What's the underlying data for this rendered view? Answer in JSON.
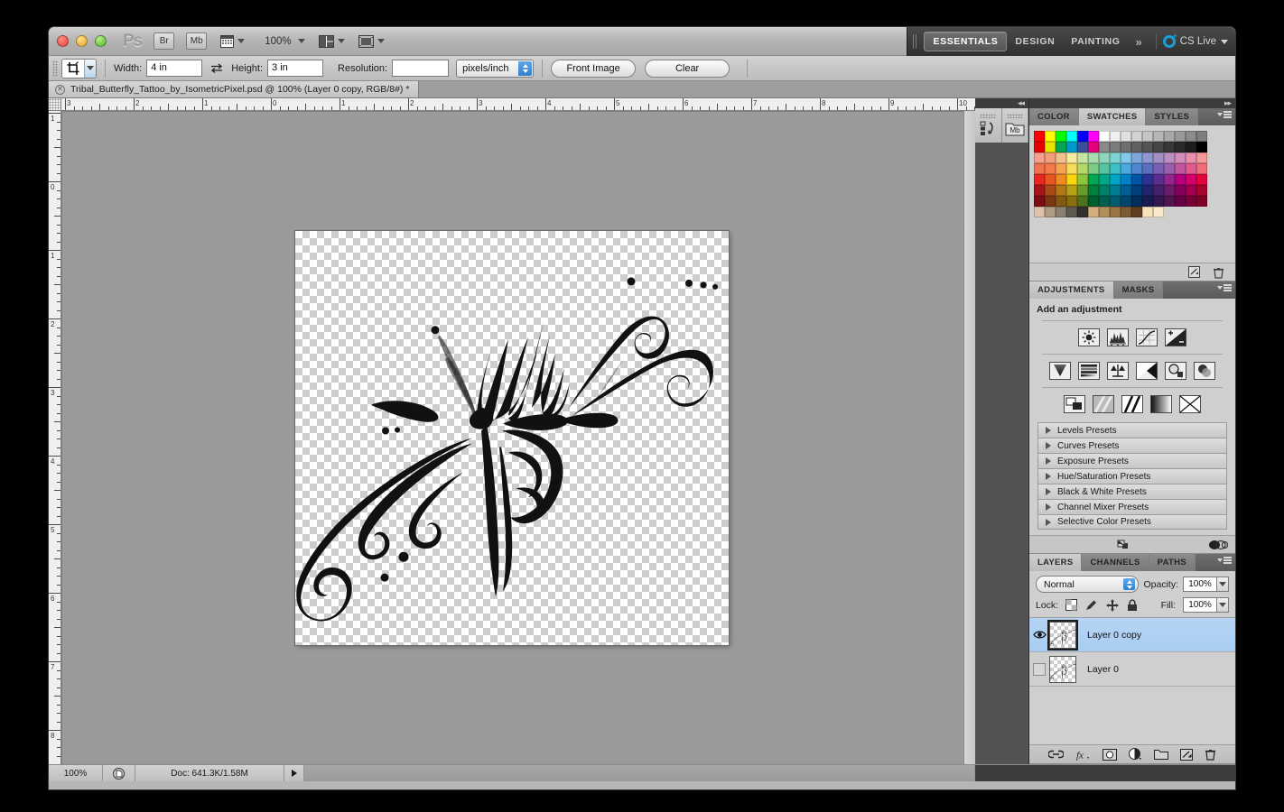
{
  "app": {
    "name": "Adobe Photoshop CS5",
    "logo_text": "Ps"
  },
  "titlebar": {
    "bridge_button": "Br",
    "minibridge_button": "Mb",
    "view_extras_icon": "view-extras-icon",
    "zoom_level": "100%",
    "arrange_icon": "arrange-documents-icon",
    "screenmode_icon": "screen-mode-icon",
    "workspaces": [
      {
        "label": "ESSENTIALS",
        "active": true
      },
      {
        "label": "DESIGN",
        "active": false
      },
      {
        "label": "PAINTING",
        "active": false
      }
    ],
    "more_workspaces": "»",
    "cs_live": "CS Live"
  },
  "options_bar": {
    "tool_icon": "crop-tool-icon",
    "width_label": "Width:",
    "width_value": "4 in",
    "swap_icon": "swap-dimensions-icon",
    "height_label": "Height:",
    "height_value": "3 in",
    "resolution_label": "Resolution:",
    "resolution_value": "",
    "units_value": "pixels/inch",
    "front_image_button": "Front Image",
    "clear_button": "Clear"
  },
  "document_tab": {
    "close_icon": "close-document-icon",
    "title": "Tribal_Butterfly_Tattoo_by_IsometricPixel.psd @ 100% (Layer 0 copy, RGB/8#) *"
  },
  "rulers": {
    "horizontal_labels": [
      "3",
      "2",
      "1",
      "0",
      "1",
      "2",
      "3",
      "4",
      "5",
      "6",
      "7",
      "8",
      "9",
      "10"
    ],
    "vertical_labels": [
      "1",
      "0",
      "1",
      "2",
      "3",
      "4",
      "5",
      "6",
      "7",
      "8"
    ],
    "unit": "inches"
  },
  "canvas": {
    "artwork_name": "tribal-butterfly-tattoo-artwork",
    "background": "transparent-checkerboard"
  },
  "collapsed_dock": {
    "items": [
      {
        "name": "history-panel-icon",
        "label": "History"
      },
      {
        "name": "mini-bridge-panel-icon",
        "label": "Mb"
      }
    ]
  },
  "swatches_panel": {
    "tabs": [
      {
        "label": "COLOR",
        "active": false
      },
      {
        "label": "SWATCHES",
        "active": true
      },
      {
        "label": "STYLES",
        "active": false
      }
    ],
    "menu_icon": "panel-menu-icon",
    "new_swatch_icon": "new-swatch-icon",
    "delete_swatch_icon": "delete-swatch-icon",
    "colors": [
      [
        "#ff0000",
        "#ffff00",
        "#00ff00",
        "#00ffff",
        "#0000ff",
        "#ff00ff",
        "#ffffff",
        "#f0f0f0",
        "#e0e0e0",
        "#d2d2d2",
        "#c4c4c4",
        "#b6b6b6",
        "#a8a8a8",
        "#9a9a9a",
        "#8c8c8c",
        "#7e7e7e"
      ],
      [
        "#e60000",
        "#e6e600",
        "#00a651",
        "#0099cc",
        "#3b4f9e",
        "#e6007e",
        "#8a8a8a",
        "#7d7d7d",
        "#6f6f6f",
        "#616161",
        "#545454",
        "#464646",
        "#383838",
        "#2b2b2b",
        "#1d1d1d",
        "#000000"
      ],
      [
        "#f4a08b",
        "#f2a07c",
        "#f5c08a",
        "#f7e9a0",
        "#c9e3a0",
        "#a8dcae",
        "#8ed6bd",
        "#7fd2d2",
        "#84c8ea",
        "#7ea8dd",
        "#8e97cf",
        "#a18fc6",
        "#bb8fc2",
        "#d48cbb",
        "#ea8fae",
        "#f29a9a"
      ],
      [
        "#f2714f",
        "#f37b4a",
        "#f5a351",
        "#f7dc5c",
        "#b4d96a",
        "#7ecb86",
        "#57c4a2",
        "#3dbfc6",
        "#4aa9e0",
        "#4f86cf",
        "#5b6fc0",
        "#7a60b5",
        "#9a5fae",
        "#c055a0",
        "#e05b8e",
        "#ef6d78"
      ],
      [
        "#e8281f",
        "#e8561f",
        "#ef8b1f",
        "#f7d60f",
        "#8cc63f",
        "#00a651",
        "#00a887",
        "#00a5c6",
        "#0080c8",
        "#0054a6",
        "#2e3192",
        "#5c2d91",
        "#92278f",
        "#b5007d",
        "#d6006a",
        "#e3053b"
      ],
      [
        "#a81418",
        "#aa4a17",
        "#b07a16",
        "#b5a315",
        "#6b9a2c",
        "#00803e",
        "#008069",
        "#007e97",
        "#005f98",
        "#00407d",
        "#22246e",
        "#44216c",
        "#6d1a6b",
        "#88005d",
        "#a0004e",
        "#aa0430"
      ],
      [
        "#7c0d14",
        "#7d3612",
        "#825a11",
        "#876f10",
        "#4e7320",
        "#005f2e",
        "#005f4e",
        "#005d70",
        "#004670",
        "#002f5d",
        "#191b52",
        "#331850",
        "#521350",
        "#660045",
        "#780039",
        "#7d0324"
      ],
      [
        "#e0c2a8",
        "#b09b84",
        "#8a8170",
        "#5e5a4f",
        "#33312b",
        "#d4ae7c",
        "#b58e5e",
        "#9b7347",
        "#7d5a33",
        "#5e3f1f",
        "#f6e3bb",
        "#f6e8c8",
        "",
        "",
        "",
        ""
      ]
    ]
  },
  "adjustments_panel": {
    "tabs": [
      {
        "label": "ADJUSTMENTS",
        "active": true
      },
      {
        "label": "MASKS",
        "active": false
      }
    ],
    "menu_icon": "panel-menu-icon",
    "heading": "Add an adjustment",
    "icon_rows": [
      [
        "brightness-contrast-icon",
        "levels-icon",
        "curves-icon",
        "exposure-icon"
      ],
      [
        "vibrance-icon",
        "hue-saturation-icon",
        "color-balance-icon",
        "black-white-icon",
        "photo-filter-icon",
        "channel-mixer-icon"
      ],
      [
        "invert-icon",
        "posterize-icon",
        "threshold-icon",
        "gradient-map-icon",
        "selective-color-icon"
      ]
    ],
    "presets": [
      "Levels Presets",
      "Curves Presets",
      "Exposure Presets",
      "Hue/Saturation Presets",
      "Black & White Presets",
      "Channel Mixer Presets",
      "Selective Color Presets"
    ],
    "footer_icons": [
      "return-to-adjustment-list-icon",
      "toggle-layer-visibility-icon"
    ]
  },
  "layers_panel": {
    "tabs": [
      {
        "label": "LAYERS",
        "active": true
      },
      {
        "label": "CHANNELS",
        "active": false
      },
      {
        "label": "PATHS",
        "active": false
      }
    ],
    "menu_icon": "panel-menu-icon",
    "blend_mode": "Normal",
    "opacity_label": "Opacity:",
    "opacity_value": "100%",
    "lock_label": "Lock:",
    "lock_icons": [
      "lock-transparent-pixels-icon",
      "lock-image-pixels-icon",
      "lock-position-icon",
      "lock-all-icon"
    ],
    "fill_label": "Fill:",
    "fill_value": "100%",
    "layers": [
      {
        "name": "Layer 0 copy",
        "visible": true,
        "selected": true
      },
      {
        "name": "Layer 0",
        "visible": false,
        "selected": false
      }
    ],
    "footer_icons": [
      "link-layers-icon",
      "layer-style-icon",
      "add-layer-mask-icon",
      "new-fill-adjustment-layer-icon",
      "new-group-icon",
      "new-layer-icon",
      "delete-layer-icon"
    ]
  },
  "status_bar": {
    "zoom_value": "100%",
    "preview_icon": "document-preview-icon",
    "doc_info": "Doc: 641.3K/1.58M",
    "expand_icon": "status-expand-icon"
  },
  "colors": {
    "accent_blue": "#1a9fd4",
    "selection_blue": "#b6d4f5",
    "panel_gray": "#cfcfcf",
    "dock_dark": "#3c3c3c",
    "canvas_gray": "#9a9a9a"
  }
}
